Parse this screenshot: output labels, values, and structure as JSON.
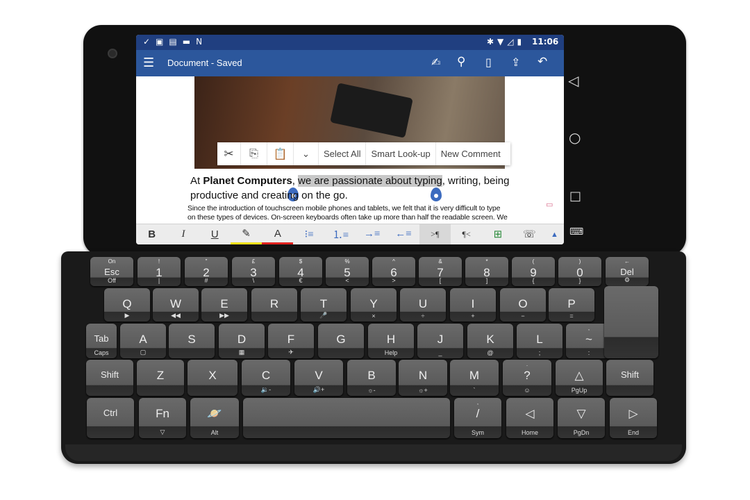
{
  "status_bar": {
    "time": "11:06",
    "left_icons": [
      "checkmark-icon",
      "image-icon",
      "clipboard-icon",
      "store-icon",
      "n-icon"
    ],
    "right_icons": [
      "bluetooth-icon",
      "wifi-icon",
      "signal-icon",
      "battery-icon"
    ]
  },
  "app_bar": {
    "title": "Document - Saved",
    "icons": [
      "draw-pen-icon",
      "search-icon",
      "mobile-view-icon",
      "share-icon",
      "undo-icon"
    ]
  },
  "context_menu": {
    "items": [
      "Select All",
      "Smart Look-up",
      "New Comment"
    ],
    "icons": [
      "cut-icon",
      "copy-icon",
      "paste-icon",
      "chevron-down-icon"
    ]
  },
  "document": {
    "line1_pre": "At ",
    "line1_bold": "Planet Computers",
    "line1_comma": ", ",
    "line1_selected": "we are passionate about typing",
    "line1_post": ", writing, being",
    "line2": "productive and creating on the go.",
    "para2_line1": "Since the introduction of touchscreen mobile phones and tablets, we felt that it is very difficult to type",
    "para2_line2": "on these types of devices. On-screen keyboards often take up more than half the readable screen. We"
  },
  "format_toolbar": {
    "bold": "B",
    "italic": "I",
    "underline": "U",
    "font_color": "A",
    "ltr": ">¶",
    "rtl": "¶<",
    "highlight_color": "#f2e11b",
    "font_color_hex": "#e0231f"
  },
  "accent_color": "#2c579c",
  "keyboard": {
    "row1": [
      [
        "Esc",
        "On",
        "Off"
      ],
      [
        "1",
        "!",
        "|"
      ],
      [
        "2",
        "\"",
        "#"
      ],
      [
        "3",
        "£",
        "\\"
      ],
      [
        "4",
        "$",
        "€"
      ],
      [
        "5",
        "%",
        "<"
      ],
      [
        "6",
        "^",
        ">"
      ],
      [
        "7",
        "&",
        "["
      ],
      [
        "8",
        "*",
        "]"
      ],
      [
        "9",
        "(",
        "{"
      ],
      [
        "0",
        ")",
        "}"
      ],
      [
        "Del",
        "←",
        "⚙"
      ]
    ],
    "row2": [
      [
        "Q",
        "",
        "▶"
      ],
      [
        "W",
        "",
        "◀◀"
      ],
      [
        "E",
        "",
        "▶▶"
      ],
      [
        "R",
        "",
        ""
      ],
      [
        "T",
        "",
        "🎤"
      ],
      [
        "Y",
        "",
        "×"
      ],
      [
        "U",
        "",
        "÷"
      ],
      [
        "I",
        "",
        "+"
      ],
      [
        "O",
        "",
        "−"
      ],
      [
        "P",
        "",
        "="
      ]
    ],
    "row3": [
      [
        "Tab",
        "",
        "Caps"
      ],
      [
        "A",
        "",
        "▢"
      ],
      [
        "S",
        "",
        ""
      ],
      [
        "D",
        "",
        "▦"
      ],
      [
        "F",
        "",
        "✈"
      ],
      [
        "G",
        "",
        ""
      ],
      [
        "H",
        "",
        "Help"
      ],
      [
        "J",
        "",
        "_"
      ],
      [
        "K",
        "",
        "@"
      ],
      [
        "L",
        "",
        ";"
      ],
      [
        "~",
        ",",
        ":"
      ]
    ],
    "row4": [
      [
        "Shift",
        "",
        ""
      ],
      [
        "Z",
        "",
        ""
      ],
      [
        "X",
        "",
        ""
      ],
      [
        "C",
        "",
        "🔉-"
      ],
      [
        "V",
        "",
        "🔊+"
      ],
      [
        "B",
        "",
        "☼-"
      ],
      [
        "N",
        "",
        "☼+"
      ],
      [
        "M",
        "",
        "`"
      ],
      [
        "?",
        ".",
        "☺"
      ],
      [
        "△",
        "",
        "PgUp"
      ],
      [
        "Shift",
        "",
        ""
      ]
    ],
    "row5": [
      [
        "Ctrl",
        "",
        ""
      ],
      [
        "Fn",
        "",
        "▽"
      ],
      [
        "🪐",
        "",
        "Alt"
      ],
      [
        "",
        "",
        ""
      ],
      [
        "/",
        ",",
        "Sym"
      ],
      [
        "◁",
        "",
        "Home"
      ],
      [
        "▽",
        "",
        "PgDn"
      ],
      [
        "▷",
        "",
        "End"
      ]
    ]
  }
}
